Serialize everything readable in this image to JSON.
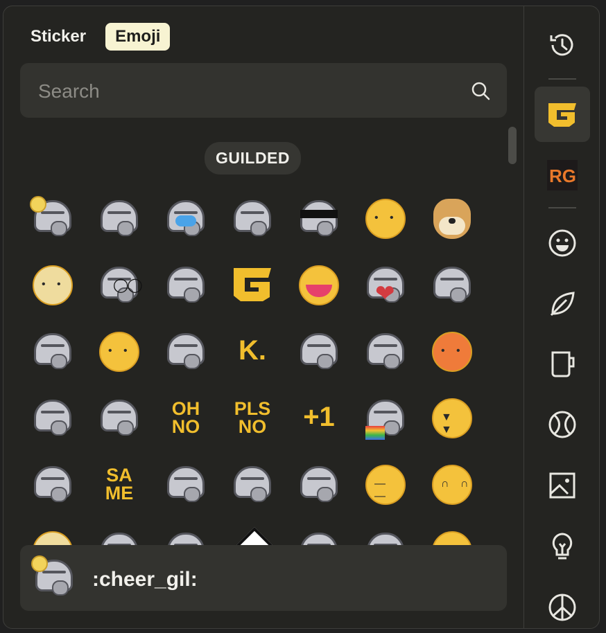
{
  "tabs": [
    {
      "label": "Sticker",
      "active": false
    },
    {
      "label": "Emoji",
      "active": true
    }
  ],
  "search": {
    "placeholder": "Search",
    "value": ""
  },
  "section": {
    "title": "GUILDED"
  },
  "emojis": [
    {
      "kind": "knight",
      "variant": "cheer",
      "icon": "cheer-knight"
    },
    {
      "kind": "knight",
      "variant": "facepalm",
      "icon": "facepalm-knight"
    },
    {
      "kind": "knight",
      "variant": "cry",
      "icon": "crying-knight"
    },
    {
      "kind": "knight",
      "variant": "salute",
      "icon": "salute-knight"
    },
    {
      "kind": "knight",
      "variant": "shades",
      "icon": "sunglasses-knight"
    },
    {
      "kind": "blob",
      "variant": "uwu",
      "icon": "uwu-blob"
    },
    {
      "kind": "doge",
      "icon": "doge"
    },
    {
      "kind": "blob",
      "variant": "bear",
      "icon": "bear-helmet"
    },
    {
      "kind": "knight",
      "variant": "googly",
      "icon": "googly-eyes-knight"
    },
    {
      "kind": "knight",
      "variant": "facepalm",
      "icon": "facepalm-knight-2"
    },
    {
      "kind": "logo",
      "icon": "guilded-logo"
    },
    {
      "kind": "blob",
      "variant": "laugh",
      "icon": "laughing-blob"
    },
    {
      "kind": "knight",
      "variant": "heart",
      "icon": "heart-knight"
    },
    {
      "kind": "knight",
      "variant": "smile",
      "icon": "smiling-knight"
    },
    {
      "kind": "knight",
      "variant": "wave",
      "icon": "wave-knight"
    },
    {
      "kind": "blob",
      "variant": "blush",
      "icon": "blushing-blob"
    },
    {
      "kind": "knight",
      "variant": "facepalm",
      "icon": "hands-knight"
    },
    {
      "kind": "text",
      "text": "K.",
      "icon": "k-dot"
    },
    {
      "kind": "knight",
      "variant": "hide",
      "icon": "hiding-knight"
    },
    {
      "kind": "knight",
      "variant": "laugh",
      "icon": "laughing-knight"
    },
    {
      "kind": "blob",
      "variant": "angry",
      "icon": "angry-blob"
    },
    {
      "kind": "knight",
      "variant": "salute",
      "icon": "peek-knight"
    },
    {
      "kind": "knight",
      "variant": "meh",
      "icon": "meh-knight"
    },
    {
      "kind": "text",
      "text": "OH NO",
      "icon": "oh-no"
    },
    {
      "kind": "text",
      "text": "PLS NO",
      "icon": "pls-no"
    },
    {
      "kind": "text",
      "text": "+1",
      "icon": "plus-one"
    },
    {
      "kind": "knight",
      "variant": "rainbow",
      "icon": "rainbow-knight"
    },
    {
      "kind": "blob",
      "variant": "sob",
      "icon": "sobbing-blob"
    },
    {
      "kind": "knight",
      "variant": "think",
      "icon": "thinking-knight"
    },
    {
      "kind": "text",
      "text": "SA ME",
      "icon": "same"
    },
    {
      "kind": "knight",
      "variant": "shock",
      "icon": "shocked-knight"
    },
    {
      "kind": "knight",
      "variant": "back",
      "icon": "back-knight"
    },
    {
      "kind": "knight",
      "variant": "facepalm",
      "icon": "facepalm-knight-3"
    },
    {
      "kind": "blob",
      "variant": "unamused",
      "icon": "unamused-blob"
    },
    {
      "kind": "blob",
      "variant": "happy",
      "icon": "happy-blob"
    },
    {
      "kind": "blob",
      "variant": "bear",
      "icon": "partial-1"
    },
    {
      "kind": "knight",
      "variant": "smile",
      "icon": "partial-2"
    },
    {
      "kind": "knight",
      "variant": "facepalm",
      "icon": "partial-3"
    },
    {
      "kind": "diamond",
      "icon": "partial-4"
    },
    {
      "kind": "knight",
      "variant": "facepalm",
      "icon": "partial-5"
    },
    {
      "kind": "knight",
      "variant": "smile",
      "icon": "partial-6"
    },
    {
      "kind": "blob",
      "variant": "happy",
      "icon": "partial-7"
    }
  ],
  "preview": {
    "name": ":cheer_gil:",
    "icon": "cheer-knight"
  },
  "rail": [
    {
      "icon": "history-icon",
      "active": false
    },
    {
      "icon": "guilded-server-icon",
      "active": true
    },
    {
      "icon": "rg-server-icon",
      "active": false
    },
    {
      "icon": "smiley-icon",
      "active": false
    },
    {
      "icon": "leaf-icon",
      "active": false
    },
    {
      "icon": "mug-icon",
      "active": false
    },
    {
      "icon": "ball-icon",
      "active": false
    },
    {
      "icon": "image-icon",
      "active": false
    },
    {
      "icon": "lightbulb-icon",
      "active": false
    },
    {
      "icon": "peace-icon",
      "active": false
    }
  ],
  "colors": {
    "accent": "#f1be2d",
    "tab_active_bg": "#f7f3d2",
    "panel": "#242421"
  }
}
